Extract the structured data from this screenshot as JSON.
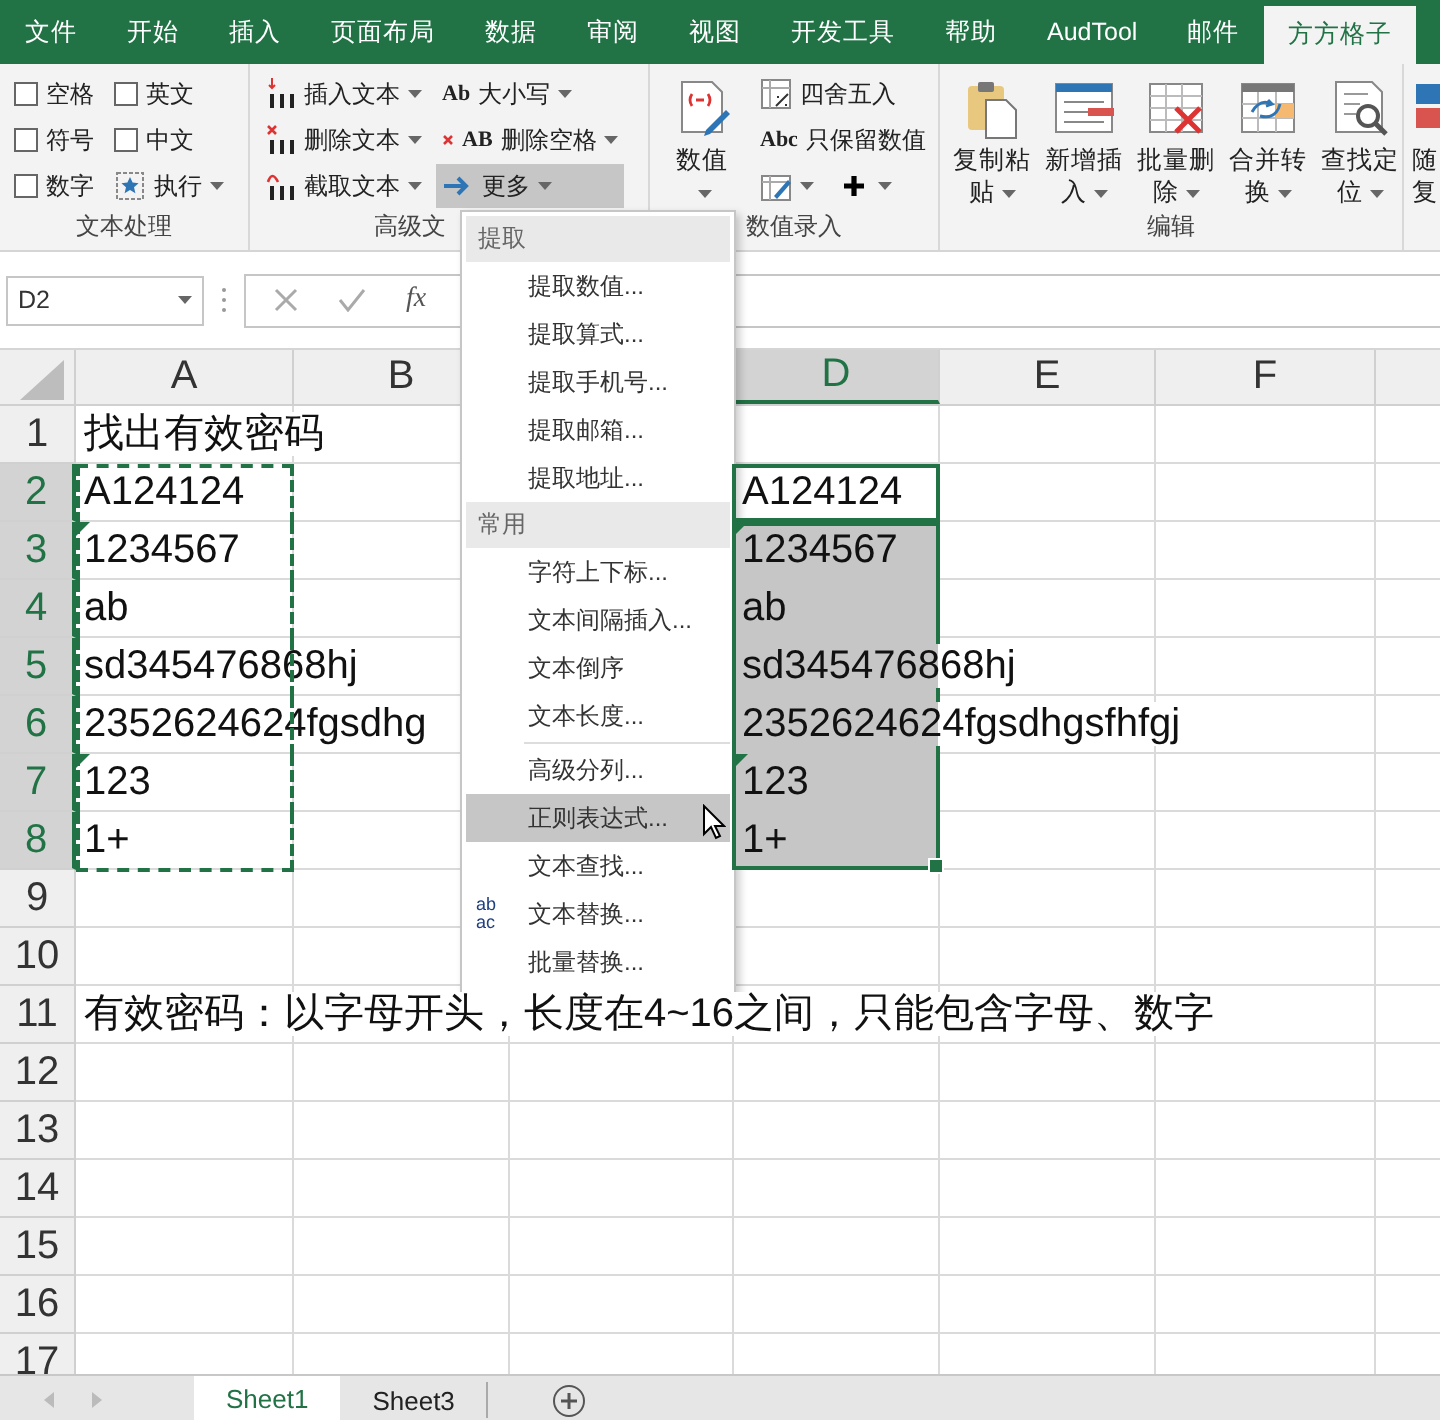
{
  "ribbon_tabs": [
    {
      "label": "文件",
      "selected": false
    },
    {
      "label": "开始",
      "selected": false
    },
    {
      "label": "插入",
      "selected": false
    },
    {
      "label": "页面布局",
      "selected": false
    },
    {
      "label": "数据",
      "selected": false
    },
    {
      "label": "审阅",
      "selected": false
    },
    {
      "label": "视图",
      "selected": false
    },
    {
      "label": "开发工具",
      "selected": false
    },
    {
      "label": "帮助",
      "selected": false
    },
    {
      "label": "AudTool",
      "selected": false
    },
    {
      "label": "邮件",
      "selected": false
    },
    {
      "label": "方方格子",
      "selected": true
    }
  ],
  "ribbon": {
    "groups": [
      {
        "title": "文本处理",
        "columns": [
          [
            {
              "kind": "checkbox",
              "label": "空格",
              "checked": false
            },
            {
              "kind": "checkbox",
              "label": "符号",
              "checked": false
            },
            {
              "kind": "checkbox",
              "label": "数字",
              "checked": false
            }
          ],
          [
            {
              "kind": "checkbox",
              "label": "英文",
              "checked": false
            },
            {
              "kind": "checkbox",
              "label": "中文",
              "checked": false
            },
            {
              "kind": "small",
              "label": "执行",
              "pressed": false,
              "dropdown": true
            }
          ]
        ]
      },
      {
        "title": "高级文",
        "columns": [
          [
            {
              "kind": "small",
              "label": "插入文本",
              "pressed": false,
              "dropdown": true
            },
            {
              "kind": "small",
              "label": "删除文本",
              "pressed": false,
              "dropdown": true
            },
            {
              "kind": "small",
              "label": "截取文本",
              "pressed": false,
              "dropdown": true
            }
          ],
          [
            {
              "kind": "small",
              "icon_text": "Ab",
              "label": "大小写",
              "pressed": false,
              "dropdown": true
            },
            {
              "kind": "small",
              "icon_text": "AB",
              "label": "删除空格",
              "pressed": false,
              "dropdown": true
            },
            {
              "kind": "small",
              "label": "更多",
              "pressed": true,
              "dropdown": true
            }
          ]
        ]
      },
      {
        "title": "数值录入",
        "columns": [
          [
            {
              "kind": "large",
              "label_lines": [
                "数值"
              ],
              "dropdown": true
            }
          ],
          [
            {
              "kind": "small",
              "label": "四舍五入",
              "pressed": false,
              "dropdown": false
            },
            {
              "kind": "small",
              "icon_text": "Abc",
              "label": "只保留数值",
              "pressed": false,
              "dropdown": false
            },
            {
              "kind": "row",
              "items": [
                {
                  "kind": "small",
                  "pressed": false,
                  "dropdown": true
                },
                {
                  "kind": "small",
                  "pressed": false,
                  "dropdown": true
                }
              ]
            }
          ]
        ]
      },
      {
        "title": "编辑",
        "columns": [
          [
            {
              "kind": "large",
              "label_lines": [
                "复制粘",
                "贴"
              ],
              "dropdown": true
            }
          ],
          [
            {
              "kind": "large",
              "label_lines": [
                "新增插",
                "入"
              ],
              "dropdown": true
            }
          ],
          [
            {
              "kind": "large",
              "label_lines": [
                "批量删",
                "除"
              ],
              "dropdown": true
            }
          ],
          [
            {
              "kind": "large",
              "label_lines": [
                "合并转",
                "换"
              ],
              "dropdown": true
            }
          ],
          [
            {
              "kind": "large",
              "label_lines": [
                "查找定",
                "位"
              ],
              "dropdown": true
            }
          ]
        ]
      },
      {
        "columns": [
          [
            {
              "kind": "large",
              "label_lines": [
                "随",
                "复"
              ],
              "dropdown": false
            }
          ]
        ]
      }
    ]
  },
  "formula_bar": {
    "name_box": "D2",
    "function_label": "fx"
  },
  "columns": [
    {
      "kind": "header",
      "label": "A",
      "selected": false
    },
    {
      "kind": "header",
      "label": "B",
      "selected": false
    },
    {
      "kind": "blank"
    },
    {
      "kind": "header",
      "label": "D",
      "selected": true
    },
    {
      "kind": "header",
      "label": "E",
      "selected": false
    },
    {
      "kind": "header",
      "label": "F",
      "selected": false
    },
    {
      "kind": "blank"
    }
  ],
  "rows": [
    {
      "number": "1",
      "selected": false,
      "column_a": {
        "text": "找出有效密码",
        "copied": false,
        "flagged": false
      }
    },
    {
      "number": "2",
      "selected": true,
      "column_a": {
        "text": "A124124",
        "copied": true,
        "flagged": false
      },
      "column_d": {
        "text": "A124124",
        "active": true,
        "flagged": false
      }
    },
    {
      "number": "3",
      "selected": true,
      "column_a": {
        "text": "1234567",
        "copied": true,
        "flagged": true
      },
      "column_d": {
        "text": "1234567",
        "active": false,
        "flagged": true
      }
    },
    {
      "number": "4",
      "selected": true,
      "column_a": {
        "text": "ab",
        "copied": true,
        "flagged": false
      },
      "column_d": {
        "text": "ab",
        "active": false,
        "flagged": false
      }
    },
    {
      "number": "5",
      "selected": true,
      "column_a": {
        "text": "sd345476868hj",
        "copied": true,
        "flagged": false
      },
      "column_d": {
        "text": "sd345476868hj",
        "active": false,
        "flagged": false
      }
    },
    {
      "number": "6",
      "selected": true,
      "column_a": {
        "text": "2352624624fgsdhg",
        "copied": true,
        "flagged": false
      },
      "column_d": {
        "text": "2352624624fgsdhgsfhfgj",
        "active": false,
        "flagged": false
      }
    },
    {
      "number": "7",
      "selected": true,
      "column_a": {
        "text": "123",
        "copied": true,
        "flagged": true
      },
      "column_d": {
        "text": "123",
        "active": false,
        "flagged": true
      }
    },
    {
      "number": "8",
      "selected": true,
      "column_a": {
        "text": "1+",
        "copied": true,
        "flagged": false
      },
      "column_d": {
        "text": "1+",
        "active": false,
        "flagged": false
      }
    },
    {
      "number": "9",
      "selected": false
    },
    {
      "number": "10",
      "selected": false
    },
    {
      "number": "11",
      "selected": false,
      "column_a": {
        "text": "有效密码：以字母开头，长度在4~16之间，只能包含字母、数字",
        "copied": false,
        "flagged": false
      }
    },
    {
      "number": "12",
      "selected": false
    },
    {
      "number": "13",
      "selected": false
    },
    {
      "number": "14",
      "selected": false
    },
    {
      "number": "15",
      "selected": false
    },
    {
      "number": "16",
      "selected": false
    },
    {
      "number": "17",
      "selected": false
    }
  ],
  "menu": {
    "items": [
      {
        "kind": "header",
        "label": "提取"
      },
      {
        "kind": "item",
        "label": "提取数值...",
        "selected": false
      },
      {
        "kind": "item",
        "label": "提取算式...",
        "selected": false
      },
      {
        "kind": "item",
        "label": "提取手机号...",
        "selected": false
      },
      {
        "kind": "item",
        "label": "提取邮箱...",
        "selected": false
      },
      {
        "kind": "item",
        "label": "提取地址...",
        "selected": false
      },
      {
        "kind": "header",
        "label": "常用"
      },
      {
        "kind": "item",
        "label": "字符上下标...",
        "selected": false
      },
      {
        "kind": "item",
        "label": "文本间隔插入...",
        "selected": false
      },
      {
        "kind": "item",
        "label": "文本倒序",
        "selected": false
      },
      {
        "kind": "item",
        "label": "文本长度...",
        "selected": false
      },
      {
        "kind": "separator"
      },
      {
        "kind": "item",
        "label": "高级分列...",
        "selected": false
      },
      {
        "kind": "item",
        "label": "正则表达式...",
        "selected": true
      },
      {
        "kind": "item",
        "label": "文本查找...",
        "selected": false
      },
      {
        "kind": "item",
        "label": "文本替换...",
        "selected": false,
        "icon_top": "ab",
        "icon_bottom": "ac"
      },
      {
        "kind": "item",
        "label": "批量替换...",
        "selected": false
      }
    ]
  },
  "sheet_tabs": [
    {
      "label": "Sheet1",
      "selected": true
    },
    {
      "label": "Sheet3",
      "selected": false
    }
  ]
}
